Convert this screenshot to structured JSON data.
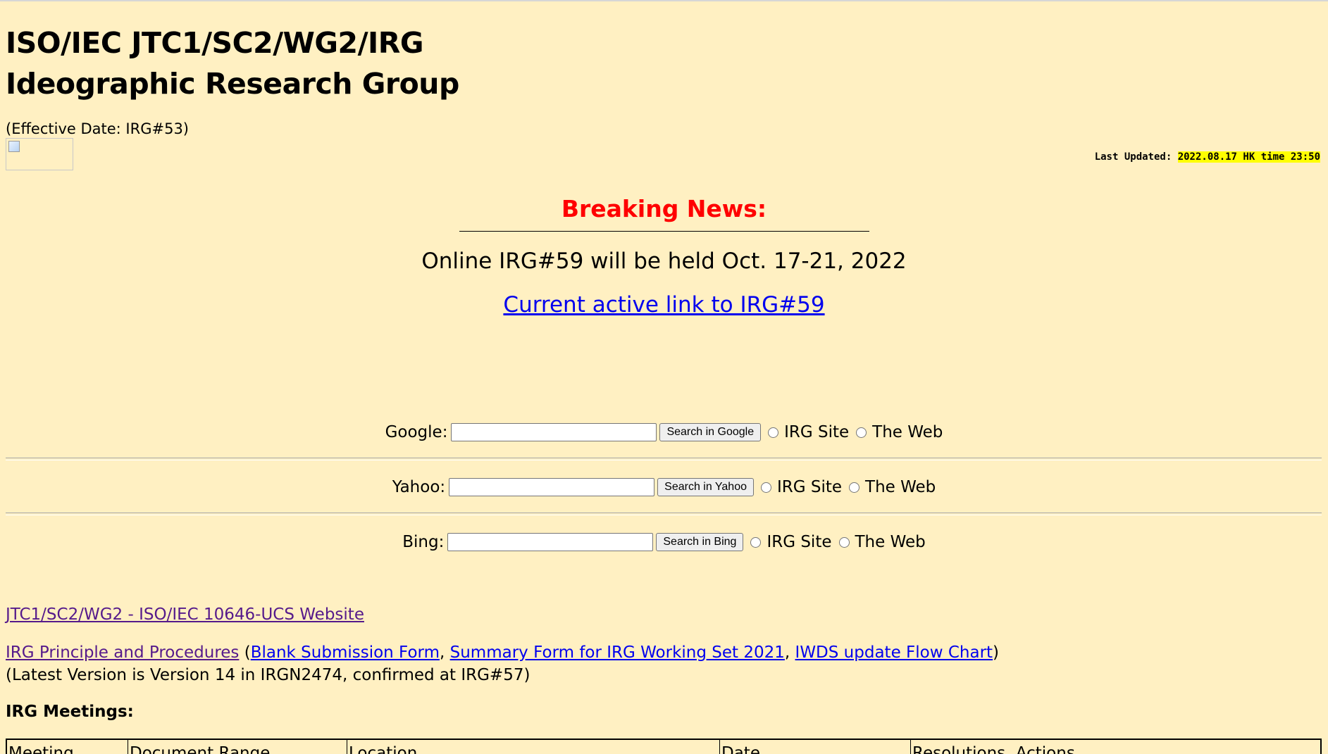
{
  "header": {
    "title_line1": "ISO/IEC JTC1/SC2/WG2/IRG",
    "title_line2": "Ideographic Research Group",
    "effective_date": "(Effective Date: IRG#53)",
    "logo_icon": "broken-image-icon",
    "last_updated_label": "Last Updated: ",
    "last_updated_value": "2022.08.17 HK time 23:50"
  },
  "news": {
    "heading": "Breaking News:",
    "text": "Online IRG#59 will be held Oct. 17-21, 2022",
    "link_text": "Current active link to IRG#59"
  },
  "search": [
    {
      "label": "Google:",
      "input_value": "",
      "button_label": "Search in Google",
      "option_irg": "IRG Site",
      "option_web": "The Web"
    },
    {
      "label": "Yahoo:",
      "input_value": "",
      "button_label": "Search in Yahoo",
      "option_irg": "IRG Site",
      "option_web": "The Web"
    },
    {
      "label": "Bing:",
      "input_value": "",
      "button_label": "Search in Bing",
      "option_irg": "IRG Site",
      "option_web": "The Web"
    }
  ],
  "links": {
    "wg2_site": "JTC1/SC2/WG2 - ISO/IEC 10646-UCS Website",
    "principles": "IRG Principle and Procedures",
    "paren_open": " (",
    "blank_form": "Blank Submission Form",
    "comma1": ", ",
    "summary_form": "Summary Form for IRG Working Set 2021",
    "comma2": ", ",
    "flow_chart": "IWDS update Flow Chart",
    "paren_close": ")",
    "version_note": "(Latest Version is Version 14 in IRGN2474,  confirmed at IRG#57)"
  },
  "meetings": {
    "heading": "IRG Meetings:",
    "columns": [
      "Meeting",
      "Document Range",
      "Location",
      "Date",
      "Resolutions, Actions"
    ]
  },
  "colors": {
    "background": "#fff0c2",
    "news_heading": "#ff0000",
    "link": "#0000ee",
    "visited_link": "#551a8b",
    "highlight": "#ffff00"
  }
}
